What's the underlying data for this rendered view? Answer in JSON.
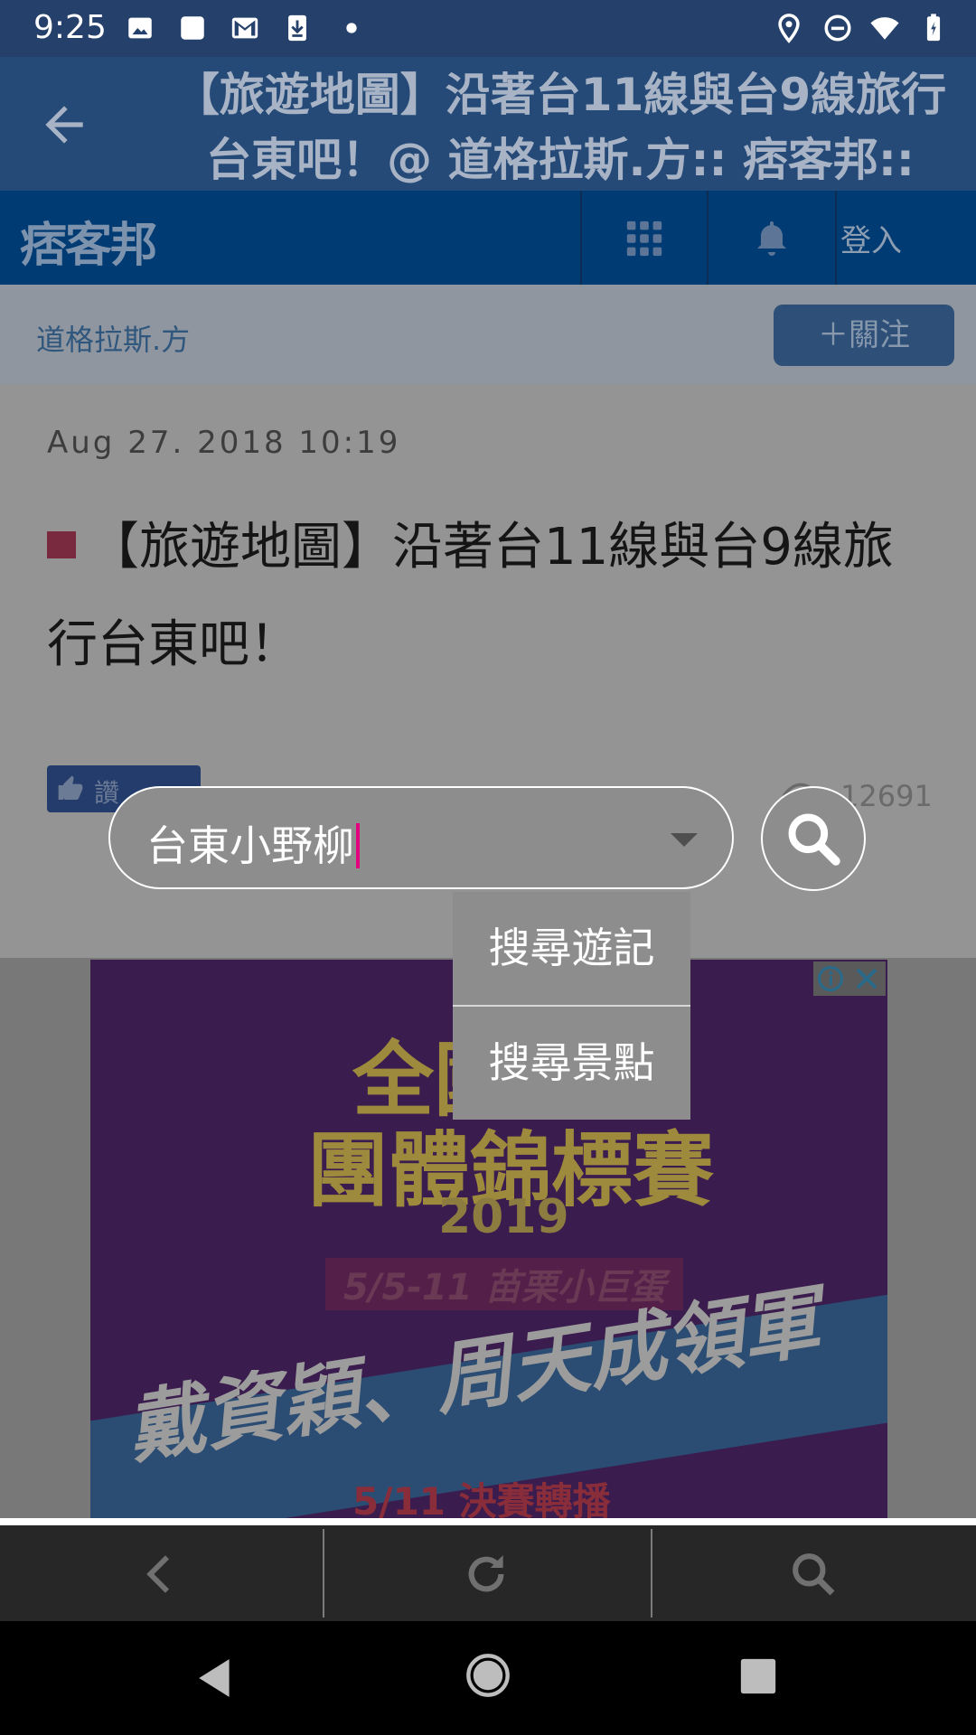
{
  "status_bar": {
    "time": "9:25",
    "icons": [
      "image-icon",
      "square-icon",
      "gmail-icon",
      "download-icon",
      "dot-icon",
      "location-icon",
      "dnd-icon",
      "wifi-icon",
      "battery-icon"
    ]
  },
  "app_bar": {
    "title": "【旅遊地圖】沿著台11線與台9線旅行台東吧！@ 道格拉斯.方:: 痞客邦::"
  },
  "pixnet_header": {
    "logo": "痞客邦",
    "login": "登入"
  },
  "blog_bar": {
    "author": "道格拉斯.方",
    "follow": "＋關注"
  },
  "post": {
    "date": "Aug 27. 2018 10:19",
    "title": "【旅遊地圖】沿著台11線與台9線旅行台東吧！",
    "like_label": "讚",
    "views": "12691"
  },
  "ad": {
    "line1": "全國",
    "line2": "團體錦標賽",
    "year": "2019",
    "dates": "5/5-11 苗栗小巨蛋",
    "headline": "戴資穎、周天成領軍",
    "final": "5/11 決賽轉播"
  },
  "search": {
    "value": "台東小野柳",
    "menu": [
      "搜尋遊記",
      "搜尋景點"
    ]
  },
  "colors": {
    "header_blue": "#003b73",
    "caret": "#e4007f"
  }
}
